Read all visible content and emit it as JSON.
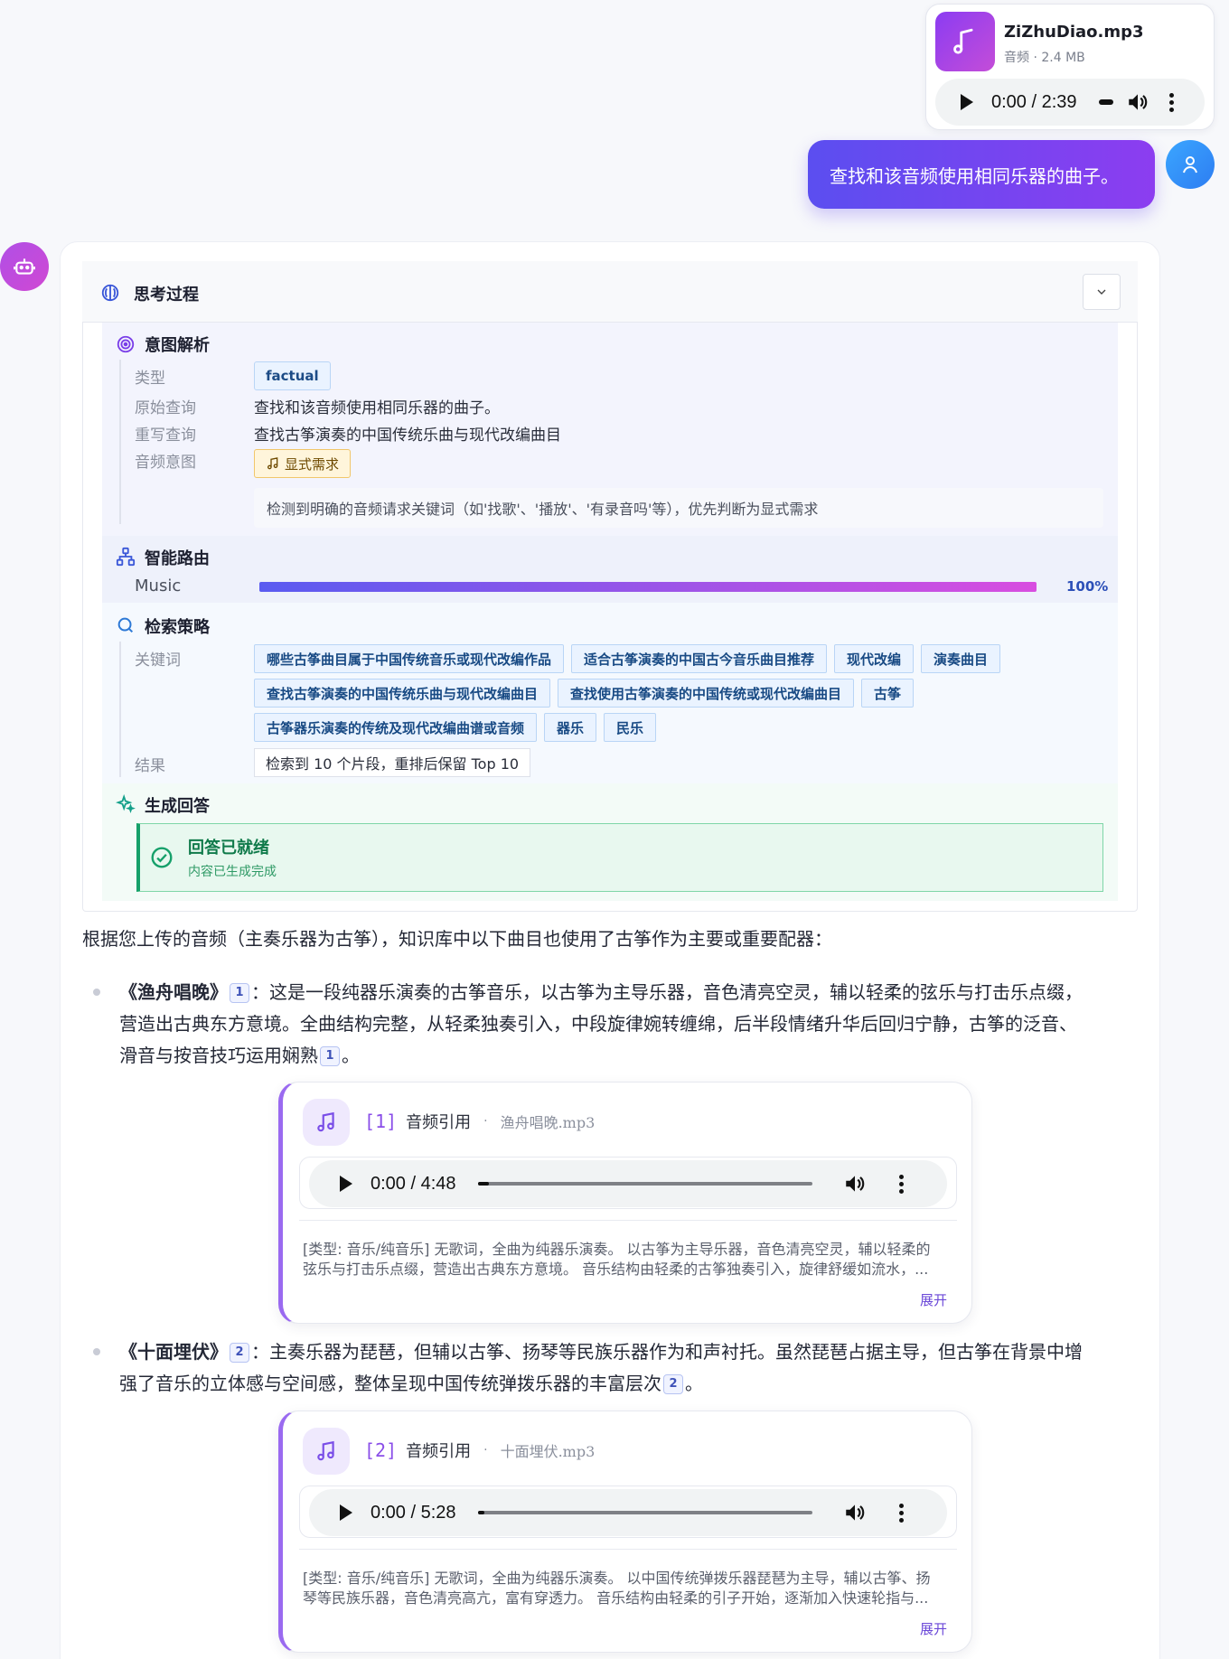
{
  "upload": {
    "filename": "ZiZhuDiao.mp3",
    "meta": "音频 · 2.4 MB",
    "player_time": "0:00 / 2:39"
  },
  "user_message": "查找和该音频使用相同乐器的曲子。",
  "thinking": {
    "title": "思考过程",
    "intent": {
      "title": "意图解析",
      "type_label": "类型",
      "type_value": "factual",
      "orig_label": "原始查询",
      "orig_value": "查找和该音频使用相同乐器的曲子。",
      "rewrite_label": "重写查询",
      "rewrite_value": "查找古筝演奏的中国传统乐曲与现代改编曲目",
      "audio_label": "音频意图",
      "audio_value": "显式需求",
      "note": "检测到明确的音频请求关键词（如'找歌'、'播放'、'有录音吗'等），优先判断为显式需求"
    },
    "routing": {
      "title": "智能路由",
      "route_name": "Music",
      "percent": "100%",
      "progress": 1.0
    },
    "search": {
      "title": "检索策略",
      "keywords_label": "关键词",
      "keywords": [
        "哪些古筝曲目属于中国传统音乐或现代改编作品",
        "适合古筝演奏的中国古今音乐曲目推荐",
        "现代改编",
        "演奏曲目",
        "查找古筝演奏的中国传统乐曲与现代改编曲目",
        "查找使用古筝演奏的中国传统或现代改编曲目",
        "古筝",
        "古筝器乐演奏的传统及现代改编曲谱或音频",
        "器乐",
        "民乐"
      ],
      "result_label": "结果",
      "result_value": "检索到 10 个片段，重排后保留 Top 10"
    },
    "generate": {
      "title": "生成回答",
      "status_title": "回答已就绪",
      "status_sub": "内容已生成完成"
    }
  },
  "answer": {
    "intro": "根据您上传的音频（主奏乐器为古筝），知识库中以下曲目也使用了古筝作为主要或重要配器：",
    "items": [
      {
        "title": "《渔舟唱晚》",
        "cite": "1",
        "text_line1": "：这是一段纯器乐演奏的古筝音乐，以古筝为主导乐器，音色清亮空灵，辅以轻柔的弦乐与打击乐点缀，",
        "text_line2": "营造出古典东方意境。全曲结构完整，从轻柔独奏引入，中段旋律婉转缠绵，后半段情绪升华后回归宁静，古筝的泛音、",
        "text_line3": "滑音与按音技巧运用娴熟",
        "end": "。",
        "ref": {
          "num": "[1]",
          "label": "音频引用",
          "sep": "·",
          "file": "渔舟唱晚.mp3",
          "time": "0:00 / 4:48",
          "progress": 0.035,
          "desc1": "[类型: 音乐/纯音乐] 无歌词，全曲为纯器乐演奏。 以古筝为主导乐器，音色清亮空灵，辅以轻柔的",
          "desc2": "弦乐与打击乐点缀，营造出古典东方意境。 音乐结构由轻柔的古筝独奏引入，旋律舒缓如流水，...",
          "expand": "展开"
        }
      },
      {
        "title": "《十面埋伏》",
        "cite": "2",
        "text_line1": "：主奏乐器为琵琶，但辅以古筝、扬琴等民族乐器作为和声衬托。虽然琵琶占据主导，但古筝在背景中增",
        "text_line2": "强了音乐的立体感与空间感，整体呈现中国传统弹拨乐器的丰富层次",
        "end": "。",
        "ref": {
          "num": "[2]",
          "label": "音频引用",
          "sep": "·",
          "file": "十面埋伏.mp3",
          "time": "0:00 / 5:28",
          "progress": 0.01,
          "desc1": "[类型: 音乐/纯音乐] 无歌词，全曲为纯器乐演奏。 以中国传统弹拨乐器琵琶为主导，辅以古筝、扬",
          "desc2": "琴等民族乐器，音色清亮高亢，富有穿透力。 音乐结构由轻柔的引子开始，逐渐加入快速轮指与...",
          "expand": "展开"
        }
      }
    ]
  },
  "colors": {
    "accent": "#6a4ef0",
    "user_bubble_start": "#5b4ef0",
    "user_bubble_end": "#8c3df0",
    "success": "#16a06a",
    "progress_start": "#5a5bf0",
    "progress_end": "#d84ee0"
  },
  "icons": {
    "upload": "music-note-icon",
    "user": "user-icon",
    "bot": "robot-icon",
    "thinking": "brain-icon",
    "intent": "target-icon",
    "routing": "network-icon",
    "search": "search-icon",
    "generate": "sparkle-icon",
    "ready": "check-circle-icon"
  }
}
